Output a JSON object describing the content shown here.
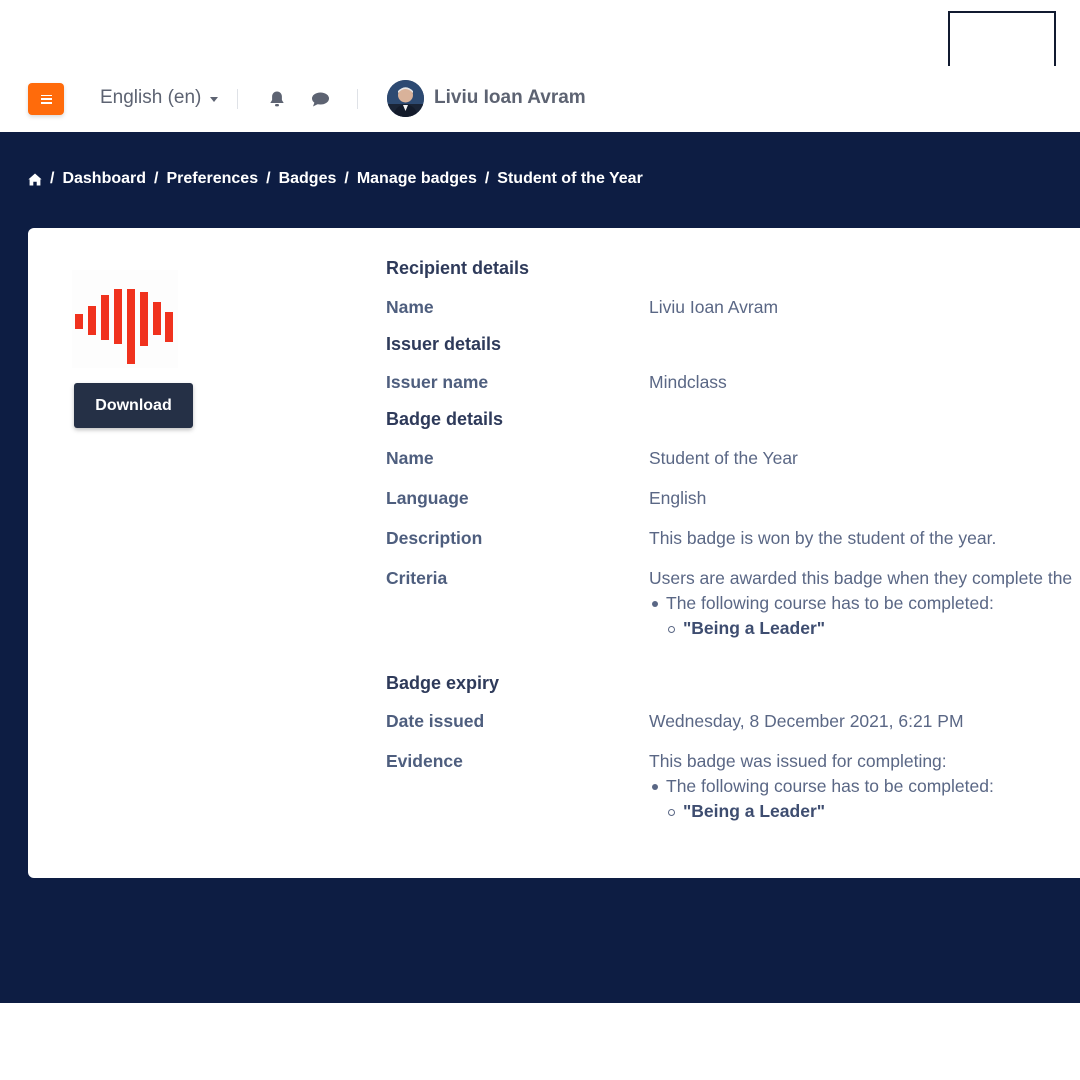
{
  "colors": {
    "accent": "#ff6b0b",
    "hero_background": "#0d1d43",
    "badge_red": "#f0321e",
    "download_button": "#253046"
  },
  "navbar": {
    "menu_icon": "hamburger-icon",
    "language": "English (en)",
    "notifications_icon": "bell-icon",
    "messages_icon": "chat-bubble-icon",
    "user_name": "Liviu Ioan Avram"
  },
  "breadcrumb": {
    "home_icon": "home-icon",
    "items": [
      "Dashboard",
      "Preferences",
      "Badges",
      "Manage badges",
      "Student of the Year"
    ]
  },
  "badge": {
    "image_icon": "soundwave-badge-icon",
    "download_label": "Download"
  },
  "details": {
    "recipient_section": "Recipient details",
    "name_label": "Name",
    "recipient_name": "Liviu Ioan Avram",
    "issuer_section": "Issuer details",
    "issuer_name_label": "Issuer name",
    "issuer_name": "Mindclass",
    "badge_section": "Badge details",
    "badge_name_label": "Name",
    "badge_name": "Student of the Year",
    "language_label": "Language",
    "language": "English",
    "description_label": "Description",
    "description": "This badge is won by the student of the year.",
    "criteria_label": "Criteria",
    "criteria_intro": "Users are awarded this badge when they complete the",
    "criteria_item": "The following course has to be completed:",
    "criteria_course": "\"Being a Leader\"",
    "expiry_section": "Badge expiry",
    "date_issued_label": "Date issued",
    "date_issued": "Wednesday, 8 December 2021, 6:21 PM",
    "evidence_label": "Evidence",
    "evidence_intro": "This badge was issued for completing:",
    "evidence_item": "The following course has to be completed:",
    "evidence_course": "\"Being a Leader\""
  }
}
